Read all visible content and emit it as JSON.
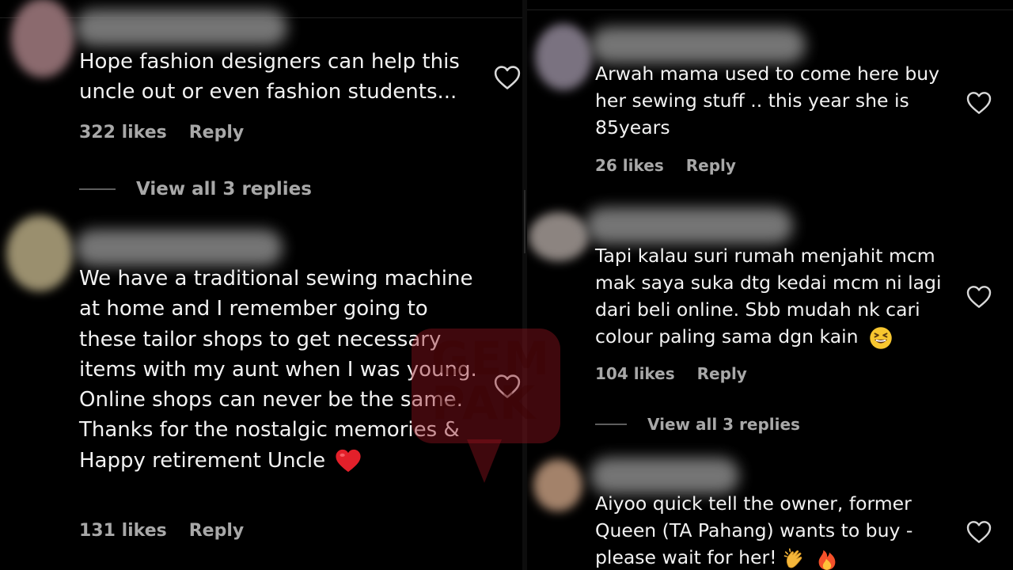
{
  "left_comments": [
    {
      "text": "Hope fashion designers can help this uncle out or even fashion students...",
      "likes": "322 likes",
      "reply": "Reply",
      "view_replies": "View all 3 replies"
    },
    {
      "text": "We have a traditional sewing machine at home and I remember going to these tailor shops to get necessary items with my aunt when I was young. Online shops can never be the same. Thanks for the nostalgic memories & Happy retirement Uncle",
      "likes": "131 likes",
      "reply": "Reply"
    }
  ],
  "right_comments": [
    {
      "text": "Arwah mama used to come here buy her sewing stuff .. this year she is 85years",
      "likes": "26 likes",
      "reply": "Reply"
    },
    {
      "text": "Tapi kalau suri rumah menjahit mcm mak saya suka dtg kedai mcm ni lagi dari beli online. Sbb mudah nk cari colour paling sama dgn kain",
      "likes": "104 likes",
      "reply": "Reply",
      "view_replies": "View all 3 replies"
    },
    {
      "text": "Aiyoo quick tell the owner, former Queen (TA Pahang) wants to buy - please wait for her!",
      "likes": "",
      "reply": ""
    }
  ],
  "watermark": {
    "text_line1": "GEM",
    "text_line2": "PAK"
  },
  "icons": [
    "heart-outline-icon",
    "red-heart-emoji",
    "grinning-squint-emoji",
    "clapping-hands-emoji",
    "fire-emoji"
  ],
  "colors": {
    "background": "#000000",
    "text": "#f2f2f2",
    "meta": "#a8a8a8",
    "watermark": "#961420"
  }
}
